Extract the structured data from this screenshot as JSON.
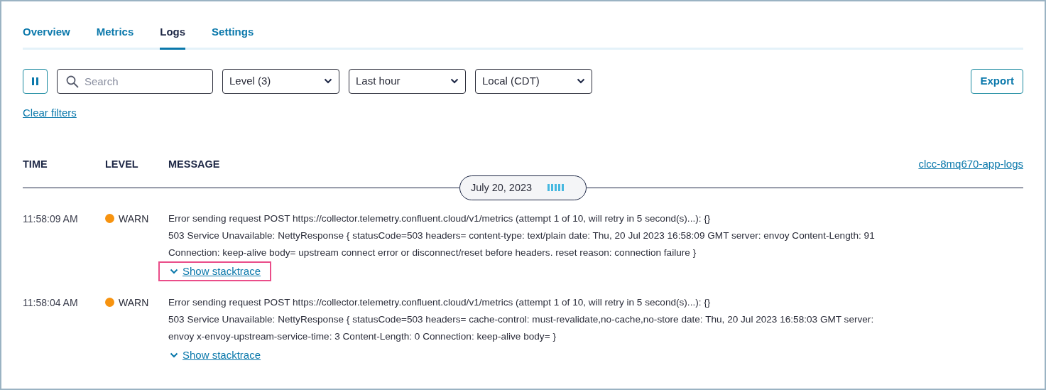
{
  "tabs": [
    {
      "label": "Overview",
      "selected": false
    },
    {
      "label": "Metrics",
      "selected": false
    },
    {
      "label": "Logs",
      "selected": true
    },
    {
      "label": "Settings",
      "selected": false
    }
  ],
  "toolbar": {
    "search": {
      "placeholder": "Search"
    },
    "dropdowns": [
      {
        "value": "Level (3)"
      },
      {
        "value": "Last hour"
      },
      {
        "value": "Local (CDT)"
      }
    ],
    "export_button": "Export",
    "clear_filters": "Clear filters"
  },
  "table": {
    "columns": [
      "TIME",
      "LEVEL",
      "MESSAGE"
    ],
    "source_link": "clcc-8mq670-app-logs",
    "date_separator": "July 20, 2023",
    "rows": [
      {
        "time": "11:58:09 AM",
        "level": "WARN",
        "color": "#f7930f",
        "message_lines": [
          "Error sending request POST https://collector.telemetry.confluent.cloud/v1/metrics (attempt 1 of 10, will retry in 5 second(s)...): {}",
          "503 Service Unavailable: NettyResponse { statusCode=503 headers= content-type: text/plain date: Thu, 20 Jul 2023 16:58:09 GMT server: envoy Content-Length: 91",
          "Connection: keep-alive body= upstream connect error or disconnect/reset before headers. reset reason: connection failure }"
        ],
        "stacktrace_link": "Show stacktrace",
        "focused": true
      },
      {
        "time": "11:58:04 AM",
        "level": "WARN",
        "color": "#f7930f",
        "message_lines": [
          "Error sending request POST https://collector.telemetry.confluent.cloud/v1/metrics (attempt 1 of 10, will retry in 5 second(s)...): {}",
          "503 Service Unavailable: NettyResponse { statusCode=503 headers= cache-control: must-revalidate,no-cache,no-store date: Thu, 20 Jul 2023 16:58:03 GMT server:",
          "envoy x-envoy-upstream-service-time: 3 Content-Length: 0 Connection: keep-alive body= }"
        ],
        "stacktrace_link": "Show stacktrace",
        "focused": false
      }
    ]
  }
}
